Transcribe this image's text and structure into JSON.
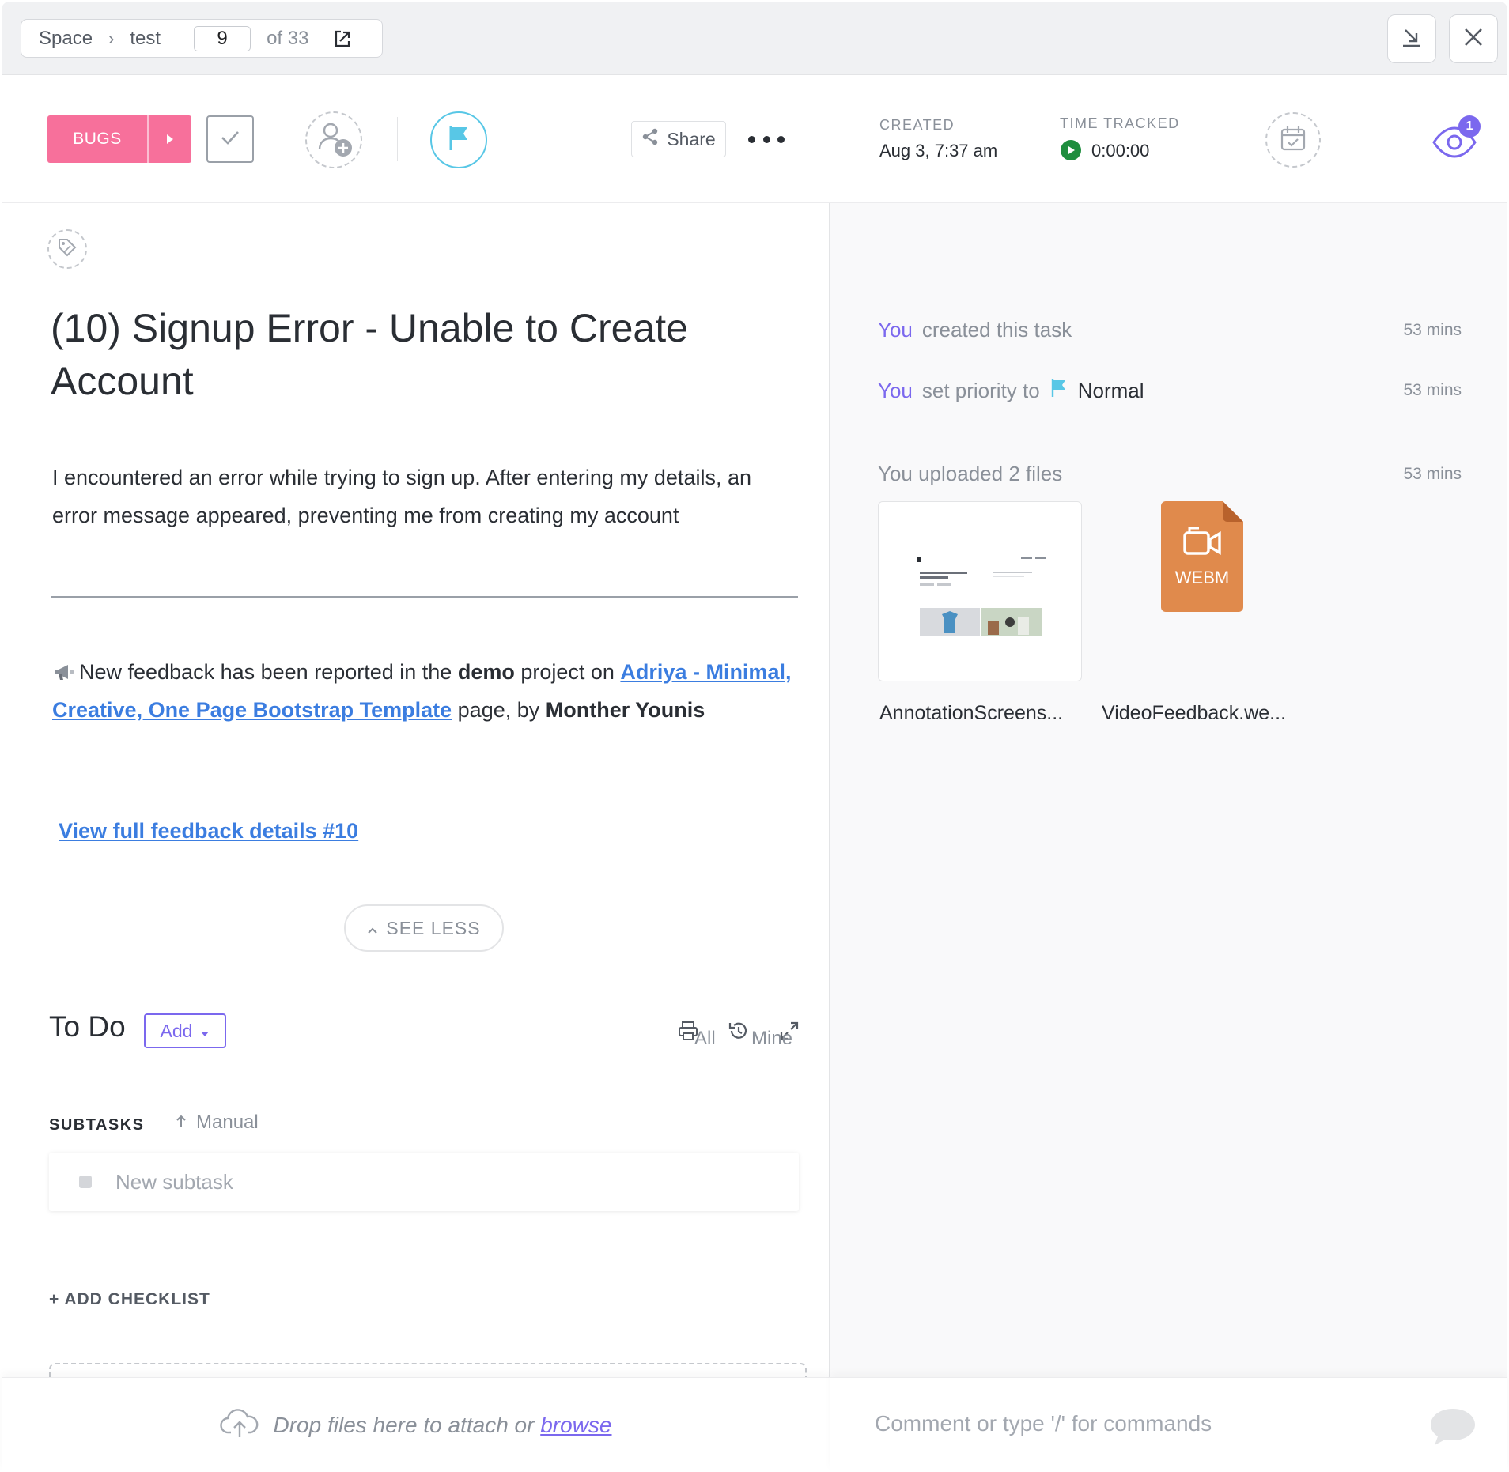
{
  "breadcrumb": {
    "space": "Space",
    "list": "test",
    "current_index": "9",
    "total": "of 33"
  },
  "header": {
    "status_label": "BUGS",
    "share_label": "Share",
    "created_label": "CREATED",
    "created_value": "Aug 3, 7:37 am",
    "time_tracked_label": "TIME TRACKED",
    "time_tracked_value": "0:00:00",
    "watchers_count": "1"
  },
  "task": {
    "title": "(10) Signup Error - Unable to Create Account",
    "description": "I encountered an error while trying to sign up. After entering my details, an error message appeared, preventing me from creating my account",
    "feedback": {
      "prefix": "New feedback has been reported in the ",
      "project": "demo",
      "middle": " project on ",
      "link_text": "Adriya - Minimal, Creative, One Page Bootstrap Template",
      "suffix": " page, by ",
      "author": "Monther Younis"
    },
    "view_link": "View full feedback details #10",
    "see_less": "SEE LESS"
  },
  "todo": {
    "title": "To Do",
    "add_label": "Add",
    "filter_all": "All",
    "filter_mine": "Mine",
    "subtasks_label": "SUBTASKS",
    "sort_label": "Manual",
    "new_subtask_placeholder": "New subtask",
    "add_checklist": "+ ADD CHECKLIST"
  },
  "footer": {
    "drop_text": "Drop files here to attach or ",
    "browse": "browse",
    "comment_placeholder": "Comment or type '/' for commands"
  },
  "activity": [
    {
      "actor": "You",
      "text": "created this task",
      "time": "53 mins"
    },
    {
      "actor": "You",
      "text": "set priority to",
      "value": "Normal",
      "time": "53 mins"
    },
    {
      "text": "You uploaded 2 files",
      "time": "53 mins"
    }
  ],
  "attachments": [
    {
      "name": "AnnotationScreens...",
      "kind": "image"
    },
    {
      "name": "VideoFeedback.we...",
      "kind": "WEBM"
    }
  ],
  "colors": {
    "status": "#f7709b",
    "accent": "#7b68ee",
    "priority_flag": "#58c7e6",
    "link": "#3b7de0",
    "file_webm": "#e08a4c",
    "timer_play": "#1e8e3e"
  },
  "icons": [
    "exit-icon",
    "minimize-icon",
    "close-icon",
    "caret-right-icon",
    "checkmark-icon",
    "add-assignee-icon",
    "flag-icon",
    "share-icon",
    "more-icon",
    "play-icon",
    "calendar-icon",
    "eye-icon",
    "tag-icon",
    "megaphone-icon",
    "chevron-up-icon",
    "print-icon",
    "history-icon",
    "expand-icon",
    "caret-down-icon",
    "arrow-up-icon",
    "cloud-upload-icon",
    "comment-bubble-icon"
  ]
}
